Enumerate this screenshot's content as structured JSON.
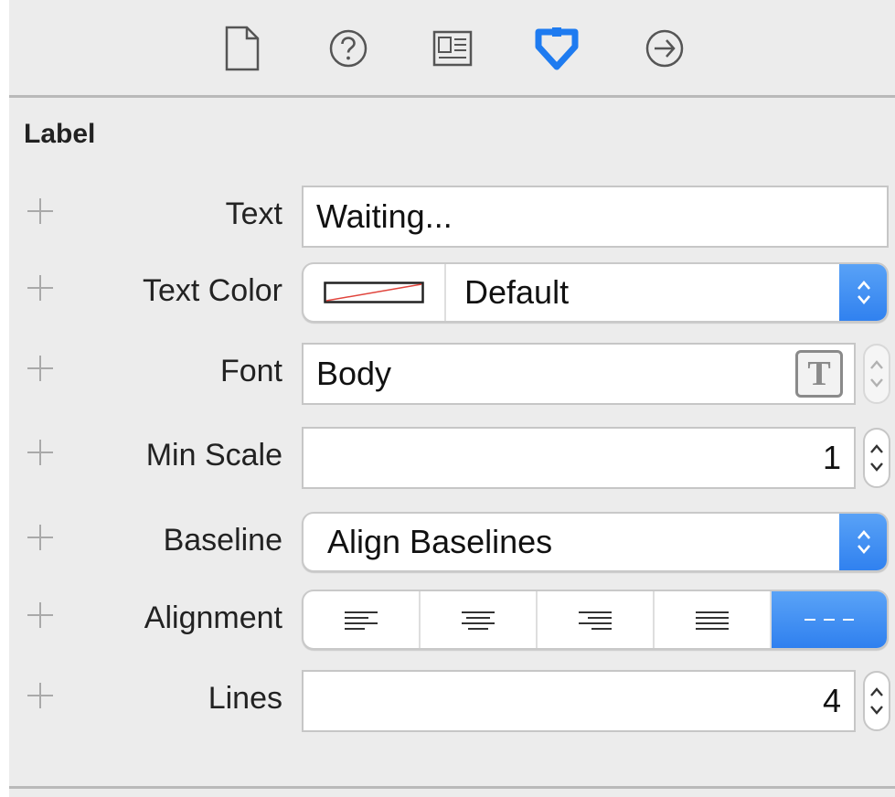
{
  "toolbar": {
    "icons": [
      "file-icon",
      "help-icon",
      "identity-icon",
      "attributes-icon",
      "connections-icon"
    ],
    "active_index": 3,
    "accent": "#1e7bf0"
  },
  "section": {
    "title": "Label"
  },
  "fields": {
    "text": {
      "label": "Text",
      "value": "Waiting..."
    },
    "text_color": {
      "label": "Text Color",
      "value": "Default"
    },
    "font": {
      "label": "Font",
      "value": "Body"
    },
    "min_scale": {
      "label": "Min Scale",
      "value": "1"
    },
    "baseline": {
      "label": "Baseline",
      "value": "Align Baselines"
    },
    "alignment": {
      "label": "Alignment",
      "options": [
        "left",
        "center",
        "right",
        "justified",
        "natural"
      ],
      "selected": "natural"
    },
    "lines": {
      "label": "Lines",
      "value": "4"
    }
  }
}
